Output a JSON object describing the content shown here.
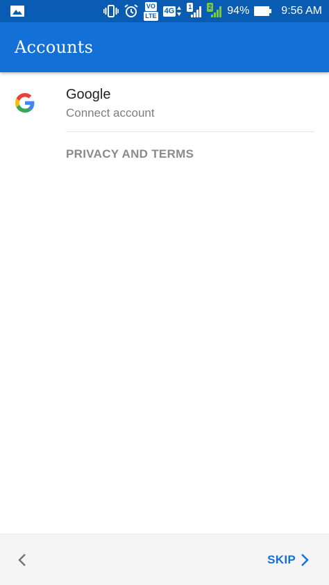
{
  "status_bar": {
    "volte_label": "VO",
    "volte_sub": "LTE",
    "network_label": "4G",
    "sim1_label": "1",
    "sim2_label": "2",
    "battery_percent": "94%",
    "time": "9:56 AM",
    "colors": {
      "background": "#0a5cb2",
      "sim2_accent": "#7ac943"
    }
  },
  "app_bar": {
    "title": "Accounts",
    "color": "#1270d6"
  },
  "accounts": [
    {
      "name": "Google",
      "subtitle": "Connect account",
      "icon": "google-logo-icon"
    }
  ],
  "privacy_link": "PRIVACY AND TERMS",
  "bottom_bar": {
    "back_icon": "chevron-left-icon",
    "skip_label": "SKIP",
    "skip_icon": "chevron-right-icon",
    "accent": "#1270d6"
  }
}
